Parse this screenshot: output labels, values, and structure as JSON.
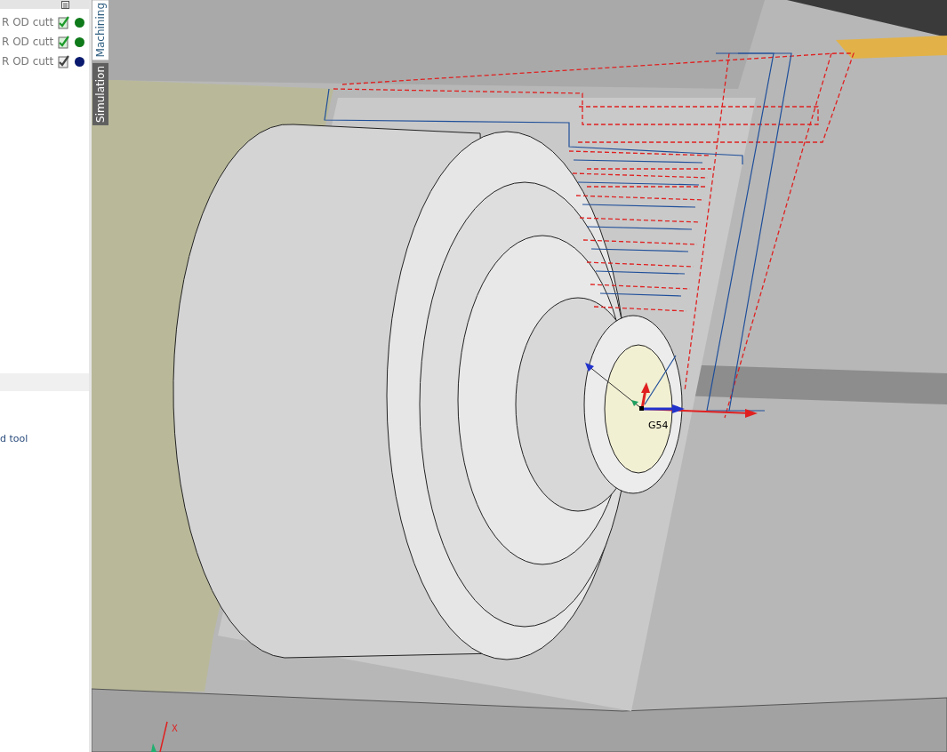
{
  "operations": [
    {
      "label": "R OD cutt",
      "verified": true,
      "color": "#0f7a1a"
    },
    {
      "label": "R OD cutt",
      "verified": true,
      "color": "#0f7a1a"
    },
    {
      "label": "R OD cutt",
      "verified": false,
      "color": "#0a1a6e"
    }
  ],
  "panel_link": "d tool",
  "tabs": [
    {
      "label": "Machining",
      "selected": true
    },
    {
      "label": "Simulation",
      "selected": false
    }
  ],
  "viewport": {
    "origin_label": "G54",
    "axis_label": "X"
  }
}
